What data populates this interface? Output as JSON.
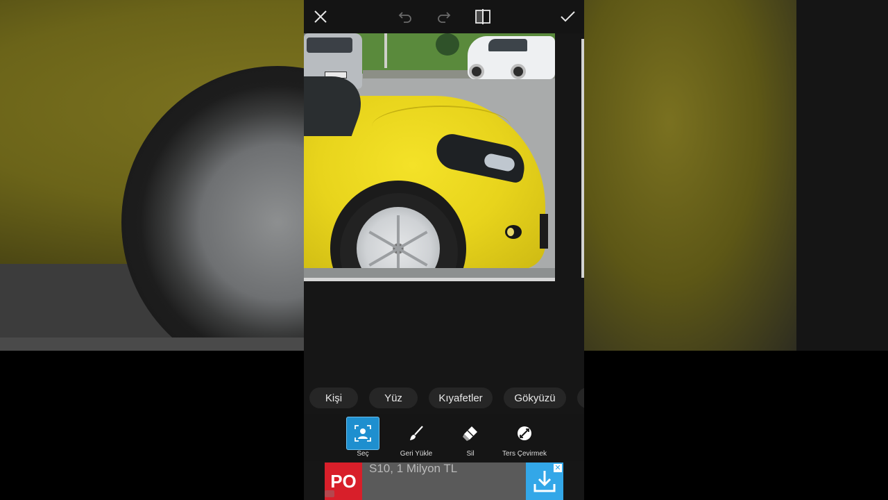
{
  "topbar": {
    "close_icon": "close-icon",
    "undo_icon": "undo-icon",
    "redo_icon": "redo-icon",
    "compare_icon": "compare-icon",
    "apply_icon": "checkmark-icon"
  },
  "categories": [
    {
      "label": "Kişi"
    },
    {
      "label": "Yüz"
    },
    {
      "label": "Kıyafetler"
    },
    {
      "label": "Gökyüzü"
    }
  ],
  "tools": [
    {
      "label": "Seç",
      "icon": "person-select-icon",
      "active": true
    },
    {
      "label": "Geri Yükle",
      "icon": "brush-icon",
      "active": false
    },
    {
      "label": "Sil",
      "icon": "eraser-icon",
      "active": false
    },
    {
      "label": "Ters Çevirmek",
      "icon": "invert-icon",
      "active": false
    }
  ],
  "ad": {
    "logo_text": "PO",
    "text": "S10, 1 Milyon TL",
    "cta_icon": "download-icon",
    "close_label": "✕"
  },
  "colors": {
    "accent": "#1e8fcf",
    "ad_logo": "#d81f2a",
    "ad_download": "#33a7e8"
  }
}
